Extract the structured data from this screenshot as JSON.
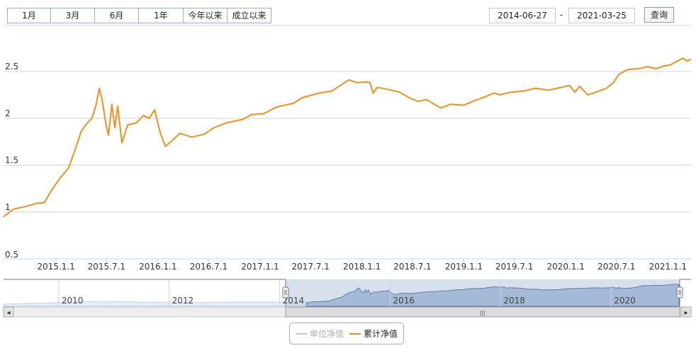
{
  "toolbar": {
    "range_buttons": [
      "1月",
      "3月",
      "6月",
      "1年",
      "今年以来",
      "成立以来"
    ],
    "start_date": "2014-06-27",
    "end_date": "2021-03-25",
    "date_separator": "-",
    "query_label": "查询"
  },
  "legend": {
    "unit_nav_label": "单位净值",
    "cumulative_nav_label": "累计净值",
    "unit_nav_color": "#c8c8c8",
    "cumulative_nav_color": "#f0901e"
  },
  "navigator": {
    "year_labels": [
      "2010",
      "2012",
      "2014",
      "2016",
      "2018",
      "2020"
    ],
    "scrollbar_left_arrow": "◂",
    "scrollbar_right_arrow": "▸",
    "scrollbar_grip": "|||"
  },
  "chart_data": {
    "type": "line",
    "title": "",
    "xlabel": "",
    "ylabel": "",
    "ylim": [
      0.5,
      2.5
    ],
    "y_ticks": [
      {
        "value": 0.5,
        "label": "0.5"
      },
      {
        "value": 1,
        "label": "1"
      },
      {
        "value": 1.5,
        "label": "1.5"
      },
      {
        "value": 2,
        "label": "2"
      },
      {
        "value": 2.5,
        "label": "2.5"
      }
    ],
    "x_range": [
      "2014-06-27",
      "2021-03-25"
    ],
    "x_ticks": [
      {
        "date": "2015-01-01",
        "label": "2015.1.1"
      },
      {
        "date": "2015-07-01",
        "label": "2015.7.1"
      },
      {
        "date": "2016-01-01",
        "label": "2016.1.1"
      },
      {
        "date": "2016-07-01",
        "label": "2016.7.1"
      },
      {
        "date": "2017-01-01",
        "label": "2017.1.1"
      },
      {
        "date": "2017-07-01",
        "label": "2017.7.1"
      },
      {
        "date": "2018-01-01",
        "label": "2018.1.1"
      },
      {
        "date": "2018-07-01",
        "label": "2018.7.1"
      },
      {
        "date": "2019-01-01",
        "label": "2019.1.1"
      },
      {
        "date": "2019-07-01",
        "label": "2019.7.1"
      },
      {
        "date": "2020-01-01",
        "label": "2020.1.1"
      },
      {
        "date": "2020-07-01",
        "label": "2020.7.1"
      },
      {
        "date": "2021-01-01",
        "label": "2021.1.1"
      }
    ],
    "grid": true,
    "legend_position": "bottom-center",
    "series": [
      {
        "name": "累计净值",
        "color": "#f0901e",
        "points": [
          [
            "2014-06-27",
            0.95
          ],
          [
            "2014-08-01",
            1.03
          ],
          [
            "2014-09-15",
            1.06
          ],
          [
            "2014-10-20",
            1.09
          ],
          [
            "2014-11-20",
            1.1
          ],
          [
            "2014-12-20",
            1.25
          ],
          [
            "2015-01-15",
            1.36
          ],
          [
            "2015-02-15",
            1.47
          ],
          [
            "2015-03-10",
            1.66
          ],
          [
            "2015-04-01",
            1.86
          ],
          [
            "2015-04-20",
            1.94
          ],
          [
            "2015-05-10",
            2.0
          ],
          [
            "2015-05-25",
            2.15
          ],
          [
            "2015-06-05",
            2.32
          ],
          [
            "2015-06-15",
            2.2
          ],
          [
            "2015-06-30",
            1.92
          ],
          [
            "2015-07-08",
            1.82
          ],
          [
            "2015-07-20",
            2.15
          ],
          [
            "2015-07-31",
            1.9
          ],
          [
            "2015-08-10",
            2.13
          ],
          [
            "2015-08-25",
            1.74
          ],
          [
            "2015-09-15",
            1.93
          ],
          [
            "2015-10-15",
            1.95
          ],
          [
            "2015-11-10",
            2.03
          ],
          [
            "2015-12-01",
            2.0
          ],
          [
            "2015-12-20",
            2.09
          ],
          [
            "2016-01-10",
            1.84
          ],
          [
            "2016-01-28",
            1.7
          ],
          [
            "2016-02-20",
            1.76
          ],
          [
            "2016-03-20",
            1.84
          ],
          [
            "2016-05-01",
            1.8
          ],
          [
            "2016-06-15",
            1.83
          ],
          [
            "2016-07-20",
            1.9
          ],
          [
            "2016-09-01",
            1.95
          ],
          [
            "2016-11-01",
            1.99
          ],
          [
            "2016-12-01",
            2.04
          ],
          [
            "2017-01-15",
            2.05
          ],
          [
            "2017-03-01",
            2.12
          ],
          [
            "2017-05-01",
            2.16
          ],
          [
            "2017-06-01",
            2.22
          ],
          [
            "2017-08-01",
            2.27
          ],
          [
            "2017-09-15",
            2.29
          ],
          [
            "2017-10-15",
            2.35
          ],
          [
            "2017-11-15",
            2.41
          ],
          [
            "2017-12-15",
            2.38
          ],
          [
            "2018-01-15",
            2.39
          ],
          [
            "2018-01-30",
            2.38
          ],
          [
            "2018-02-10",
            2.27
          ],
          [
            "2018-02-25",
            2.33
          ],
          [
            "2018-04-01",
            2.31
          ],
          [
            "2018-05-15",
            2.28
          ],
          [
            "2018-06-20",
            2.22
          ],
          [
            "2018-07-20",
            2.18
          ],
          [
            "2018-08-20",
            2.2
          ],
          [
            "2018-10-10",
            2.11
          ],
          [
            "2018-11-15",
            2.15
          ],
          [
            "2019-01-01",
            2.14
          ],
          [
            "2019-02-01",
            2.18
          ],
          [
            "2019-03-10",
            2.22
          ],
          [
            "2019-04-20",
            2.27
          ],
          [
            "2019-05-10",
            2.25
          ],
          [
            "2019-06-20",
            2.28
          ],
          [
            "2019-08-01",
            2.29
          ],
          [
            "2019-09-15",
            2.32
          ],
          [
            "2019-11-01",
            2.3
          ],
          [
            "2019-12-01",
            2.32
          ],
          [
            "2020-01-15",
            2.35
          ],
          [
            "2020-02-03",
            2.28
          ],
          [
            "2020-02-20",
            2.34
          ],
          [
            "2020-03-20",
            2.25
          ],
          [
            "2020-04-20",
            2.28
          ],
          [
            "2020-05-25",
            2.32
          ],
          [
            "2020-06-20",
            2.38
          ],
          [
            "2020-07-10",
            2.47
          ],
          [
            "2020-08-10",
            2.52
          ],
          [
            "2020-09-20",
            2.53
          ],
          [
            "2020-10-20",
            2.55
          ],
          [
            "2020-11-20",
            2.53
          ],
          [
            "2020-12-20",
            2.56
          ],
          [
            "2021-01-10",
            2.57
          ],
          [
            "2021-02-10",
            2.62
          ],
          [
            "2021-02-25",
            2.64
          ],
          [
            "2021-03-10",
            2.61
          ],
          [
            "2021-03-25",
            2.63
          ]
        ]
      }
    ]
  }
}
